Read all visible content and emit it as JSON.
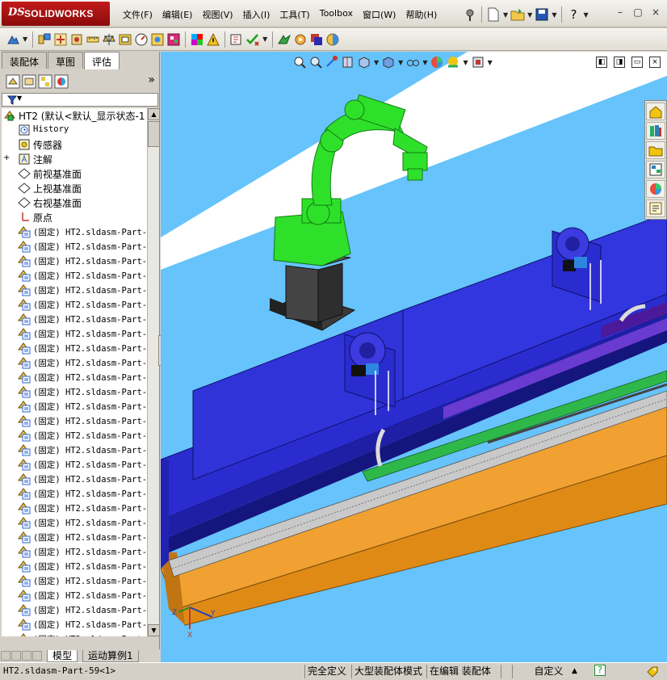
{
  "app": {
    "logo_prefix": "DS",
    "logo_text": "SOLIDWORKS"
  },
  "menu": [
    "文件(F)",
    "编辑(E)",
    "视图(V)",
    "插入(I)",
    "工具(T)",
    "Toolbox",
    "窗口(W)",
    "帮助(H)"
  ],
  "window_controls": [
    "?",
    "–",
    "▢",
    "×"
  ],
  "tabs": [
    "装配体",
    "草图",
    "评估"
  ],
  "active_tab": "评估",
  "feature_manager": {
    "more_glyph": "»",
    "root": "HT2  (默认<默认_显示状态-1",
    "items": [
      {
        "label": "History",
        "icon": "history-icon",
        "expand": ""
      },
      {
        "label": "传感器",
        "icon": "sensor-icon",
        "expand": ""
      },
      {
        "label": "注解",
        "icon": "annotation-icon",
        "expand": "+"
      },
      {
        "label": "前视基准面",
        "icon": "plane-icon",
        "expand": ""
      },
      {
        "label": "上视基准面",
        "icon": "plane-icon",
        "expand": ""
      },
      {
        "label": "右视基准面",
        "icon": "plane-icon",
        "expand": ""
      },
      {
        "label": "原点",
        "icon": "origin-icon",
        "expand": ""
      }
    ],
    "part_label": "(固定) HT2.sldasm-Part-",
    "part_count": 29
  },
  "bottom_tabs": [
    "模型",
    "运动算例1"
  ],
  "statusbar": {
    "selection": "HT2.sldasm-Part-59<1>",
    "state": "完全定义",
    "mode": "大型装配体模式",
    "editing": "在编辑 装配体",
    "units": "自定义",
    "help": "?"
  },
  "colors": {
    "viewport_bg": "#66c3fb",
    "floor_white": "#ffffff",
    "robot": "#2fe02a",
    "rail": "#2b2ccf",
    "orange": "#e99720",
    "base": "#333333",
    "accent_blue": "#2f86e0"
  },
  "icons": {
    "toolbar2": [
      "explode-icon",
      "assembly-icon",
      "mate-icon",
      "component-icon",
      "measure-icon",
      "mass-icon",
      "section-icon",
      "interference-icon",
      "hole-icon",
      "appearance-icon",
      "warning-icon",
      "smart-icon",
      "check-icon",
      "plugin-icon",
      "rebuild-icon",
      "color-icon",
      "render-icon"
    ],
    "taskpane": [
      "home-icon",
      "design-library-icon",
      "file-explorer-icon",
      "view-palette-icon",
      "appearances-icon",
      "custom-properties-icon"
    ]
  },
  "triad": {
    "x": "X",
    "y": "Y",
    "z": "Z"
  }
}
